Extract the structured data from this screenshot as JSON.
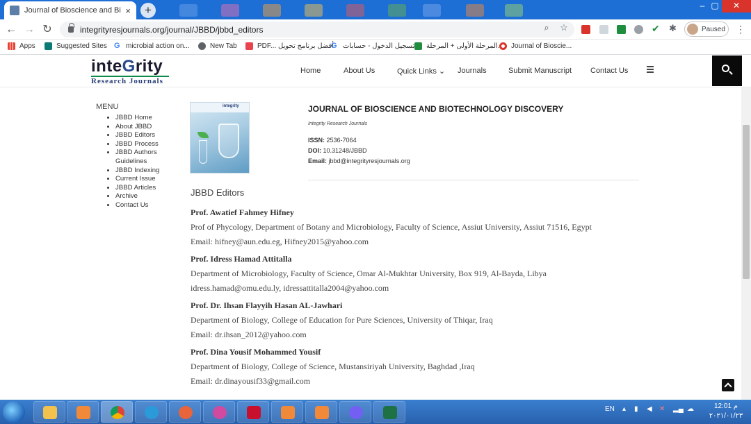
{
  "browser": {
    "tab_title": "Journal of Bioscience and Biotech",
    "tab_close": "×",
    "new_tab": "+",
    "url": "integrityresjournals.org/journal/JBBD/jbbd_editors",
    "profile_status": "Paused",
    "window_controls": [
      "–",
      "▢",
      "✕"
    ],
    "bookmarks": [
      {
        "label": "Apps",
        "icon": "apps-grid-icon"
      },
      {
        "label": "Suggested Sites",
        "icon": "bing-icon"
      },
      {
        "label": "microbial action on...",
        "icon": "google-icon"
      },
      {
        "label": "New Tab",
        "icon": "globe-icon"
      },
      {
        "label": "PDF... أفضل برنامج تحويل",
        "icon": "pdf-tool-icon"
      },
      {
        "label": "تسجيل الدخول - حسابات...",
        "icon": "google-icon"
      },
      {
        "label": "المرحلة الأولى + المرحلة...",
        "icon": "classroom-icon"
      },
      {
        "label": "Journal of Bioscie...",
        "icon": "journal-icon"
      }
    ]
  },
  "site": {
    "logo_top_a": "inte",
    "logo_top_b": "G",
    "logo_top_c": "rity",
    "logo_bottom": "Research Journals",
    "nav": [
      {
        "label": "Home"
      },
      {
        "label": "About Us"
      },
      {
        "label": "Quick Links ⌄"
      },
      {
        "label": "Journals"
      },
      {
        "label": "Submit Manuscript"
      },
      {
        "label": "Contact Us"
      }
    ]
  },
  "menu": {
    "title": "MENU",
    "items": [
      "JBBD Home",
      "About JBBD",
      "JBBD Editors",
      "JBBD Process",
      "JBBD Authors Guidelines",
      "JBBD Indexing",
      "Current Issue",
      "JBBD Articles",
      "Archive",
      "Contact Us"
    ]
  },
  "journal": {
    "cover_label": "integrity",
    "title": "JOURNAL OF BIOSCIENCE AND BIOTECHNOLOGY DISCOVERY",
    "publisher": "Integrity Research Journals",
    "issn_label": "ISSN:",
    "issn": "2536-7064",
    "doi_label": "DOI:",
    "doi": "10.31248/JBBD",
    "email_label": "Email:",
    "email": "jbbd@integrityresjournals.org"
  },
  "editors_section": {
    "title": "JBBD Editors",
    "editors": [
      {
        "name": "Prof. Awatief Fahmey Hifney",
        "affiliation": "Prof of Phycology, Department of Botany and Microbiology, Faculty of Science, Assiut University, Assiut 71516, Egypt",
        "email": "Email: hifney@aun.edu.eg, Hifney2015@yahoo.com"
      },
      {
        "name": "Prof. Idress Hamad Attitalla",
        "affiliation": "Department of Microbiology, Faculty of Science, Omar Al-Mukhtar University, Box 919, Al-Bayda, Libya",
        "email": "idress.hamad@omu.edu.ly, idressattitalla2004@yahoo.com"
      },
      {
        "name": "Prof. Dr. Ihsan Flayyih Hasan AL-Jawhari",
        "affiliation": "Department of Biology, College of Education for Pure Sciences, University of Thiqar, Iraq",
        "email": "Email: dr.ihsan_2012@yahoo.com"
      },
      {
        "name": "Prof. Dina Yousif Mohammed Yousif",
        "affiliation": "Department of Biology, College of Science, Mustansiriyah University, Baghdad ,Iraq",
        "email": "Email: dr.dinayousif33@gmail.com"
      }
    ]
  },
  "taskbar": {
    "language": "EN",
    "time": "12:01 م",
    "date": "٢٠٢١/٠١/٢٣"
  }
}
